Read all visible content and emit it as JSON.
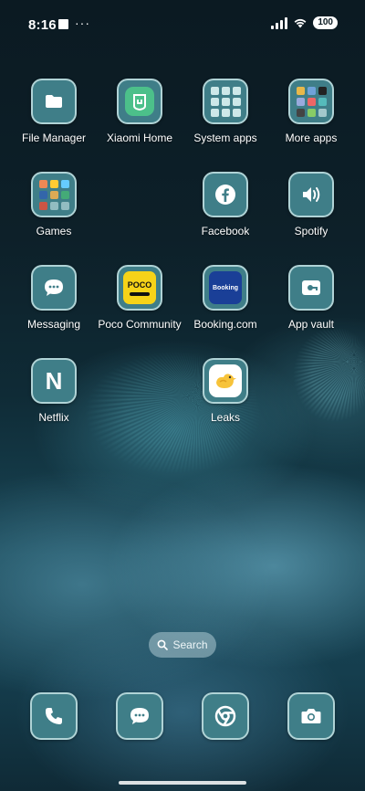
{
  "status_bar": {
    "time": "8:16",
    "dots": "···",
    "battery": "100"
  },
  "apps": {
    "file_manager": "File Manager",
    "xiaomi_home": "Xiaomi Home",
    "system_apps": "System apps",
    "more_apps": "More apps",
    "games": "Games",
    "facebook": "Facebook",
    "spotify": "Spotify",
    "messaging": "Messaging",
    "poco_community": "Poco Community",
    "poco_logo_text": "POCO",
    "booking": "Booking.com",
    "booking_logo_text": "Booking",
    "app_vault": "App vault",
    "netflix": "Netflix",
    "netflix_logo_text": "N",
    "leaks": "Leaks"
  },
  "search": {
    "label": "Search"
  },
  "colors": {
    "tile": "#3f7e88",
    "tile_border": "#d7f0f0",
    "poco_yellow": "#f6d318",
    "booking_blue": "#1a3f97",
    "xiaomi_green": "#4cc08a"
  }
}
